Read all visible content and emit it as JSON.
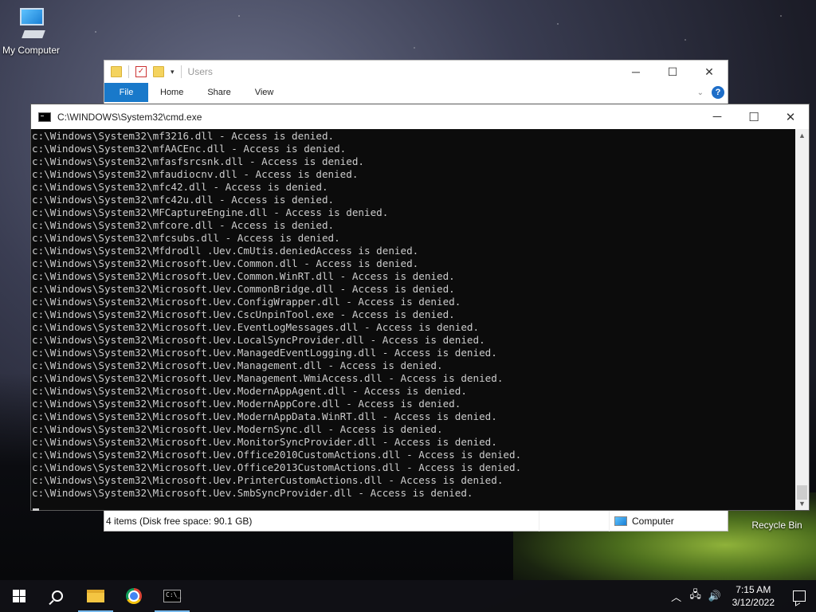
{
  "desktop": {
    "icons": [
      {
        "label": "My Computer"
      },
      {
        "label": "Recycle Bin"
      }
    ]
  },
  "explorer": {
    "title": "Users",
    "tabs": [
      "File",
      "Home",
      "Share",
      "View"
    ],
    "status_items": "4 items (Disk free space: 90.1 GB)",
    "status_location": "Computer",
    "controls": {
      "minimize": "─",
      "maximize": "☐",
      "close": "✕"
    }
  },
  "cmd": {
    "title": "C:\\WINDOWS\\System32\\cmd.exe",
    "controls": {
      "minimize": "─",
      "maximize": "☐",
      "close": "✕"
    },
    "lines": [
      "c:\\Windows\\System32\\mf3216.dll - Access is denied.",
      "c:\\Windows\\System32\\mfAACEnc.dll - Access is denied.",
      "c:\\Windows\\System32\\mfasfsrcsnk.dll - Access is denied.",
      "c:\\Windows\\System32\\mfaudiocnv.dll - Access is denied.",
      "c:\\Windows\\System32\\mfc42.dll - Access is denied.",
      "c:\\Windows\\System32\\mfc42u.dll - Access is denied.",
      "c:\\Windows\\System32\\MFCaptureEngine.dll - Access is denied.",
      "c:\\Windows\\System32\\mfcore.dll - Access is denied.",
      "c:\\Windows\\System32\\mfcsubs.dll - Access is denied.",
      "c:\\Windows\\System32\\Mfdrodll .Uev.CmUtis.deniedAccess is denied.",
      "c:\\Windows\\System32\\Microsoft.Uev.Common.dll - Access is denied.",
      "c:\\Windows\\System32\\Microsoft.Uev.Common.WinRT.dll - Access is denied.",
      "c:\\Windows\\System32\\Microsoft.Uev.CommonBridge.dll - Access is denied.",
      "c:\\Windows\\System32\\Microsoft.Uev.ConfigWrapper.dll - Access is denied.",
      "c:\\Windows\\System32\\Microsoft.Uev.CscUnpinTool.exe - Access is denied.",
      "c:\\Windows\\System32\\Microsoft.Uev.EventLogMessages.dll - Access is denied.",
      "c:\\Windows\\System32\\Microsoft.Uev.LocalSyncProvider.dll - Access is denied.",
      "c:\\Windows\\System32\\Microsoft.Uev.ManagedEventLogging.dll - Access is denied.",
      "c:\\Windows\\System32\\Microsoft.Uev.Management.dll - Access is denied.",
      "c:\\Windows\\System32\\Microsoft.Uev.Management.WmiAccess.dll - Access is denied.",
      "c:\\Windows\\System32\\Microsoft.Uev.ModernAppAgent.dll - Access is denied.",
      "c:\\Windows\\System32\\Microsoft.Uev.ModernAppCore.dll - Access is denied.",
      "c:\\Windows\\System32\\Microsoft.Uev.ModernAppData.WinRT.dll - Access is denied.",
      "c:\\Windows\\System32\\Microsoft.Uev.ModernSync.dll - Access is denied.",
      "c:\\Windows\\System32\\Microsoft.Uev.MonitorSyncProvider.dll - Access is denied.",
      "c:\\Windows\\System32\\Microsoft.Uev.Office2010CustomActions.dll - Access is denied.",
      "c:\\Windows\\System32\\Microsoft.Uev.Office2013CustomActions.dll - Access is denied.",
      "c:\\Windows\\System32\\Microsoft.Uev.PrinterCustomActions.dll - Access is denied.",
      "c:\\Windows\\System32\\Microsoft.Uev.SmbSyncProvider.dll - Access is denied."
    ]
  },
  "taskbar": {
    "time": "7:15 AM",
    "date": "3/12/2022",
    "tray_icons": [
      "chevron-up-icon",
      "network-icon",
      "volume-icon"
    ]
  },
  "colors": {
    "accent": "#1979ca",
    "console_bg": "#0c0c0c",
    "console_fg": "#cccccc"
  }
}
